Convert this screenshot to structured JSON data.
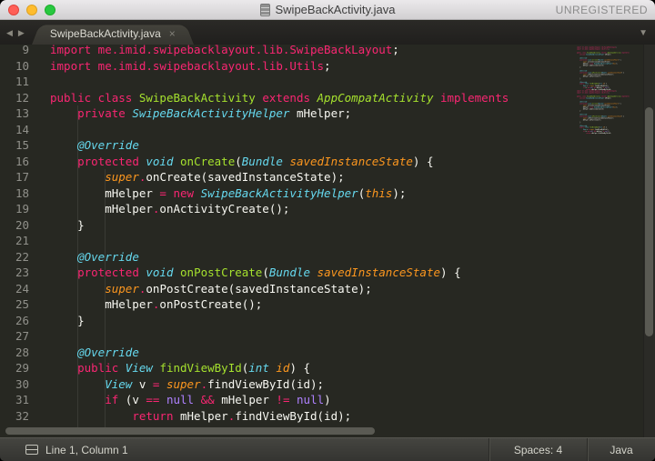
{
  "window": {
    "title": "SwipeBackActivity.java",
    "license": "UNREGISTERED"
  },
  "icons": {
    "back": "◀",
    "forward": "▶",
    "overflow": "▼",
    "close": "×"
  },
  "tab_bar": {
    "tab": {
      "label": "SwipeBackActivity.java"
    }
  },
  "colors": {
    "editor_background": "#272822",
    "keyword_pink": "#f92672",
    "entity_green": "#a6e22e",
    "type_blue": "#66d9ef",
    "param_orange": "#fd971f",
    "constant_purple": "#ae81ff",
    "foreground": "#f8f8f2",
    "line_number": "#90908a"
  },
  "editor": {
    "lines": [
      {
        "n": 9,
        "toks": [
          [
            "import me.imid.swipebacklayout.lib.SwipeBackLayout",
            "pink"
          ],
          [
            ";",
            "fg"
          ]
        ]
      },
      {
        "n": 10,
        "toks": [
          [
            "import me.imid.swipebacklayout.lib.Utils",
            "pink"
          ],
          [
            ";",
            "fg"
          ]
        ]
      },
      {
        "n": 11,
        "toks": []
      },
      {
        "n": 12,
        "toks": [
          [
            "public class ",
            "pink"
          ],
          [
            "SwipeBackActivity",
            "green"
          ],
          [
            " ",
            "fg"
          ],
          [
            "extends",
            "pink"
          ],
          [
            " ",
            "fg"
          ],
          [
            "AppCompatActivity",
            "greeni"
          ],
          [
            " ",
            "fg"
          ],
          [
            "implements",
            "pink"
          ]
        ]
      },
      {
        "n": 13,
        "toks": [
          [
            "    ",
            "fg"
          ],
          [
            "private",
            "pink"
          ],
          [
            " ",
            "fg"
          ],
          [
            "SwipeBackActivityHelper",
            "bluei"
          ],
          [
            " mHelper",
            "fg"
          ],
          [
            ";",
            "fg"
          ]
        ]
      },
      {
        "n": 14,
        "toks": []
      },
      {
        "n": 15,
        "toks": [
          [
            "    ",
            "fg"
          ],
          [
            "@Override",
            "bluei"
          ]
        ]
      },
      {
        "n": 16,
        "toks": [
          [
            "    ",
            "fg"
          ],
          [
            "protected",
            "pink"
          ],
          [
            " ",
            "fg"
          ],
          [
            "void",
            "bluei"
          ],
          [
            " ",
            "fg"
          ],
          [
            "onCreate",
            "green"
          ],
          [
            "(",
            "fg"
          ],
          [
            "Bundle",
            "bluei"
          ],
          [
            " ",
            "fg"
          ],
          [
            "savedInstanceState",
            "orangei"
          ],
          [
            ") {",
            "fg"
          ]
        ]
      },
      {
        "n": 17,
        "toks": [
          [
            "        ",
            "fg"
          ],
          [
            "super",
            "orangei"
          ],
          [
            ".",
            "pink"
          ],
          [
            "onCreate(savedInstanceState);",
            "fg"
          ]
        ]
      },
      {
        "n": 18,
        "toks": [
          [
            "        mHelper ",
            "fg"
          ],
          [
            "=",
            "pink"
          ],
          [
            " ",
            "fg"
          ],
          [
            "new",
            "pink"
          ],
          [
            " ",
            "fg"
          ],
          [
            "SwipeBackActivityHelper",
            "bluei"
          ],
          [
            "(",
            "fg"
          ],
          [
            "this",
            "orangei"
          ],
          [
            ");",
            "fg"
          ]
        ]
      },
      {
        "n": 19,
        "toks": [
          [
            "        mHelper",
            "fg"
          ],
          [
            ".",
            "pink"
          ],
          [
            "onActivityCreate();",
            "fg"
          ]
        ]
      },
      {
        "n": 20,
        "toks": [
          [
            "    }",
            "fg"
          ]
        ]
      },
      {
        "n": 21,
        "toks": []
      },
      {
        "n": 22,
        "toks": [
          [
            "    ",
            "fg"
          ],
          [
            "@Override",
            "bluei"
          ]
        ]
      },
      {
        "n": 23,
        "toks": [
          [
            "    ",
            "fg"
          ],
          [
            "protected",
            "pink"
          ],
          [
            " ",
            "fg"
          ],
          [
            "void",
            "bluei"
          ],
          [
            " ",
            "fg"
          ],
          [
            "onPostCreate",
            "green"
          ],
          [
            "(",
            "fg"
          ],
          [
            "Bundle",
            "bluei"
          ],
          [
            " ",
            "fg"
          ],
          [
            "savedInstanceState",
            "orangei"
          ],
          [
            ") {",
            "fg"
          ]
        ]
      },
      {
        "n": 24,
        "toks": [
          [
            "        ",
            "fg"
          ],
          [
            "super",
            "orangei"
          ],
          [
            ".",
            "pink"
          ],
          [
            "onPostCreate(savedInstanceState);",
            "fg"
          ]
        ]
      },
      {
        "n": 25,
        "toks": [
          [
            "        mHelper",
            "fg"
          ],
          [
            ".",
            "pink"
          ],
          [
            "onPostCreate();",
            "fg"
          ]
        ]
      },
      {
        "n": 26,
        "toks": [
          [
            "    }",
            "fg"
          ]
        ]
      },
      {
        "n": 27,
        "toks": []
      },
      {
        "n": 28,
        "toks": [
          [
            "    ",
            "fg"
          ],
          [
            "@Override",
            "bluei"
          ]
        ]
      },
      {
        "n": 29,
        "toks": [
          [
            "    ",
            "fg"
          ],
          [
            "public",
            "pink"
          ],
          [
            " ",
            "fg"
          ],
          [
            "View",
            "bluei"
          ],
          [
            " ",
            "fg"
          ],
          [
            "findViewById",
            "green"
          ],
          [
            "(",
            "fg"
          ],
          [
            "int",
            "bluei"
          ],
          [
            " ",
            "fg"
          ],
          [
            "id",
            "orangei"
          ],
          [
            ") {",
            "fg"
          ]
        ]
      },
      {
        "n": 30,
        "toks": [
          [
            "        ",
            "fg"
          ],
          [
            "View",
            "bluei"
          ],
          [
            " v ",
            "fg"
          ],
          [
            "=",
            "pink"
          ],
          [
            " ",
            "fg"
          ],
          [
            "super",
            "orangei"
          ],
          [
            ".",
            "pink"
          ],
          [
            "findViewById(id);",
            "fg"
          ]
        ]
      },
      {
        "n": 31,
        "toks": [
          [
            "        ",
            "fg"
          ],
          [
            "if",
            "pink"
          ],
          [
            " (v ",
            "fg"
          ],
          [
            "==",
            "pink"
          ],
          [
            " ",
            "fg"
          ],
          [
            "null",
            "purple"
          ],
          [
            " ",
            "fg"
          ],
          [
            "&&",
            "pink"
          ],
          [
            " mHelper ",
            "fg"
          ],
          [
            "!=",
            "pink"
          ],
          [
            " ",
            "fg"
          ],
          [
            "null",
            "purple"
          ],
          [
            ")",
            "fg"
          ]
        ]
      },
      {
        "n": 32,
        "toks": [
          [
            "            ",
            "fg"
          ],
          [
            "return",
            "pink"
          ],
          [
            " mHelper",
            "fg"
          ],
          [
            ".",
            "pink"
          ],
          [
            "findViewById(id);",
            "fg"
          ]
        ]
      }
    ]
  },
  "status_bar": {
    "position": "Line 1, Column 1",
    "spaces": "Spaces: 4",
    "syntax": "Java"
  }
}
